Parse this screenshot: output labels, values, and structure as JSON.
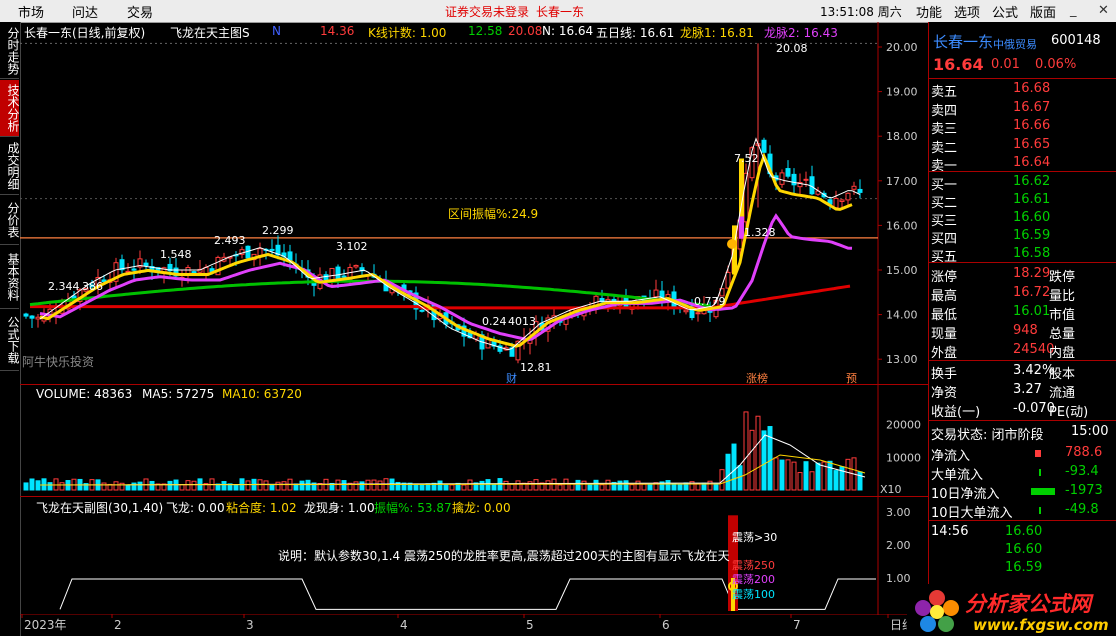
{
  "menu": {
    "market": "市场",
    "ask": "问达",
    "trade": "交易",
    "warning": "证券交易未登录",
    "warning_stock": "长春一东",
    "clock": "13:51:08 周六",
    "func": "功能",
    "options": "选项",
    "formula": "公式",
    "layout": "版面"
  },
  "left_tabs": [
    "分时走势",
    "技术分析",
    "成交明细",
    "分价表",
    "基本资料",
    "公式下载"
  ],
  "main_header": {
    "stock": "长春一东(日线,前复权)",
    "indicator": "飞龙在天主图S",
    "i1": "N",
    "i1v": "14.36",
    "i2": "K线计数: 1.00",
    "i3": "12.58",
    "i4": "20.08",
    "i5": "N: 16.64",
    "i6": "五日线: 16.61",
    "i7": "龙脉1: 16.81",
    "i8": "龙脉2: 16.43"
  },
  "main_labels": {
    "p2344": "2.344",
    "p386": "386",
    "p1548": "1.548",
    "p2493": "2.493",
    "p2299": "2.299",
    "p3102": "3.102",
    "p024": "0.24",
    "p4013": "4013",
    "p0779": "0.779",
    "p1328": "1.328",
    "p752": "7.52",
    "p2008": "20.08",
    "p1281": "12.81",
    "zone": "区间振幅%:24.9",
    "watermark": "阿牛快乐投资",
    "tag_cai": "财",
    "tag_zhang": "涨榜",
    "tag_yu": "预"
  },
  "main_axis": [
    "20.00",
    "19.00",
    "18.00",
    "17.00",
    "16.00",
    "15.00",
    "14.00",
    "13.00"
  ],
  "vol_header": {
    "volume": "VOLUME: 48363",
    "ma5": "MA5: 57275",
    "ma10": "MA10: 63720"
  },
  "vol_axis": [
    "20000",
    "10000"
  ],
  "vol_unit": "X10",
  "sub_header": {
    "name": "飞龙在天副图(30,1.40)",
    "fl": "飞龙: 0.00",
    "nh": "粘合度: 1.02",
    "lx": "龙现身: 1.00",
    "zf": "振幅%: 53.87",
    "ql": "擒龙: 0.00"
  },
  "sub_axis": [
    "3.00",
    "2.00",
    "1.00"
  ],
  "sub_note": "说明：默认参数30,1.4 震荡250的龙胜率更高,震荡超过200天的主图有显示飞龙在天",
  "sub_labels": {
    "z30": "震荡>30",
    "z250": "震荡250",
    "z200": "震荡200",
    "z100": "震荡100"
  },
  "x_axis": [
    "2023年",
    "2",
    "3",
    "4",
    "5",
    "6",
    "7",
    "日线"
  ],
  "quote": {
    "name": "长春一东",
    "tag": "中俄贸易",
    "code": "600148",
    "price": "16.64",
    "change": "0.01",
    "pct": "0.06%",
    "sell": [
      {
        "l": "卖五",
        "p": "16.68"
      },
      {
        "l": "卖四",
        "p": "16.67"
      },
      {
        "l": "卖三",
        "p": "16.66"
      },
      {
        "l": "卖二",
        "p": "16.65"
      },
      {
        "l": "卖一",
        "p": "16.64"
      }
    ],
    "buy": [
      {
        "l": "买一",
        "p": "16.62"
      },
      {
        "l": "买二",
        "p": "16.61"
      },
      {
        "l": "买三",
        "p": "16.60"
      },
      {
        "l": "买四",
        "p": "16.59"
      },
      {
        "l": "买五",
        "p": "16.58"
      }
    ],
    "stats": [
      {
        "l": "涨停",
        "v": "18.29",
        "l2": "跌停"
      },
      {
        "l": "最高",
        "v": "16.72",
        "l2": "量比"
      },
      {
        "l": "最低",
        "v": "16.01",
        "l2": "市值"
      },
      {
        "l": "现量",
        "v": "948",
        "l2": "总量"
      },
      {
        "l": "外盘",
        "v": "24540",
        "l2": "内盘"
      }
    ],
    "stats2": [
      {
        "l": "换手",
        "v": "3.42%",
        "l2": "股本"
      },
      {
        "l": "净资",
        "v": "3.27",
        "l2": "流通"
      },
      {
        "l": "收益(一)",
        "v": "-0.070",
        "l2": "PE(动)"
      }
    ],
    "status_label": "交易状态: 闭市阶段",
    "status_time": "15:00",
    "flows": [
      {
        "l": "净流入",
        "v": "788.6"
      },
      {
        "l": "大单流入",
        "v": "-93.4"
      },
      {
        "l": "10日净流入",
        "v": "-1973"
      },
      {
        "l": "10日大单流入",
        "v": "-49.8"
      }
    ],
    "ticks": [
      {
        "t": "14:56",
        "p": "16.60"
      },
      {
        "t": "",
        "p": "16.60"
      },
      {
        "t": "",
        "p": "16.59"
      }
    ],
    "logo": "分析家公式网",
    "logo_url": "www.fxgsw.com"
  }
}
